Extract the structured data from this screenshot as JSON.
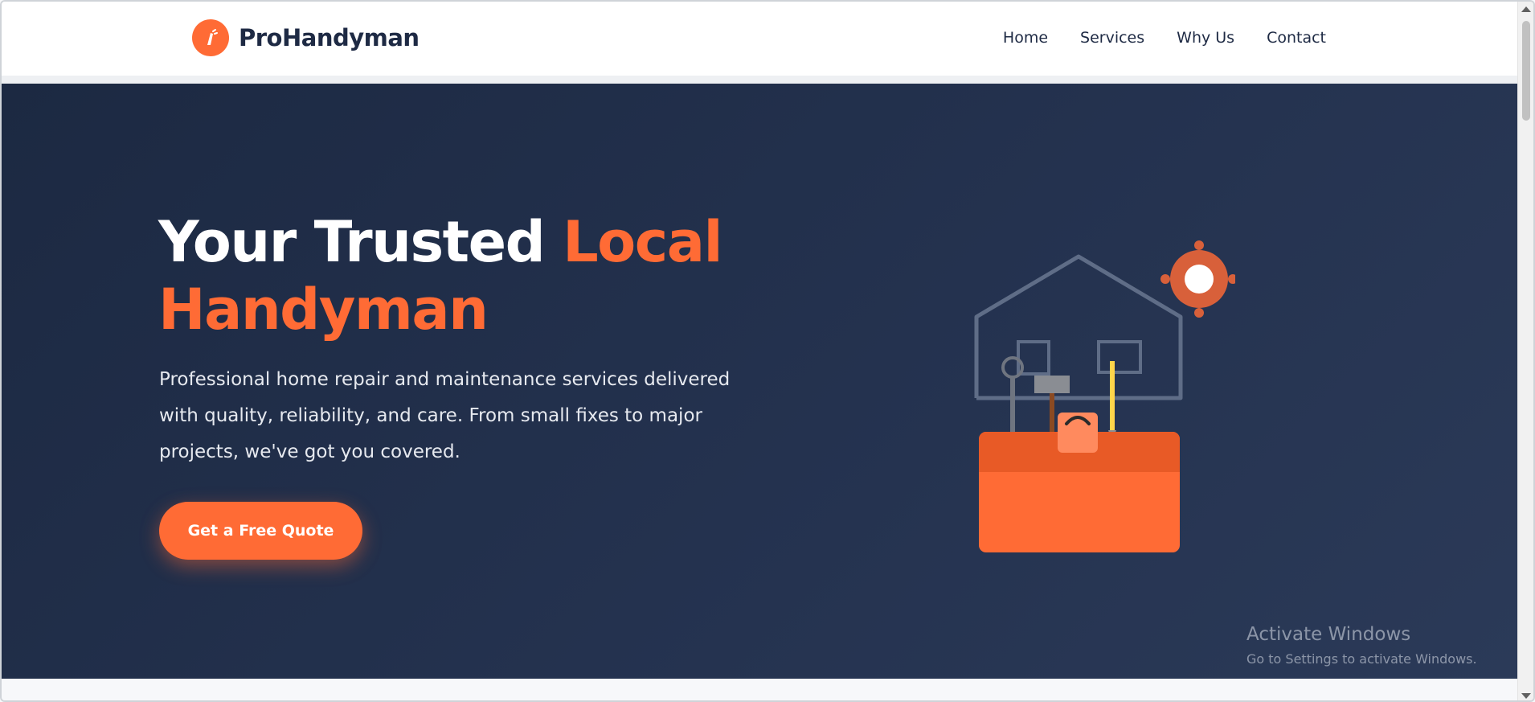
{
  "header": {
    "brand": "ProHandyman",
    "nav": [
      {
        "label": "Home"
      },
      {
        "label": "Services"
      },
      {
        "label": "Why Us"
      },
      {
        "label": "Contact"
      }
    ]
  },
  "hero": {
    "title_part1": "Your Trusted ",
    "title_accent": "Local Handyman",
    "description": "Professional home repair and maintenance services delivered with quality, reliability, and care. From small fixes to major projects, we've got you covered.",
    "cta_label": "Get a Free Quote",
    "illustration_icon": "toolbox-house-icon"
  },
  "watermark": {
    "title": "Activate Windows",
    "subtitle": "Go to Settings to activate Windows."
  },
  "colors": {
    "accent": "#ff6b35",
    "navy": "#1c2942",
    "brand_text": "#1e2a44"
  }
}
